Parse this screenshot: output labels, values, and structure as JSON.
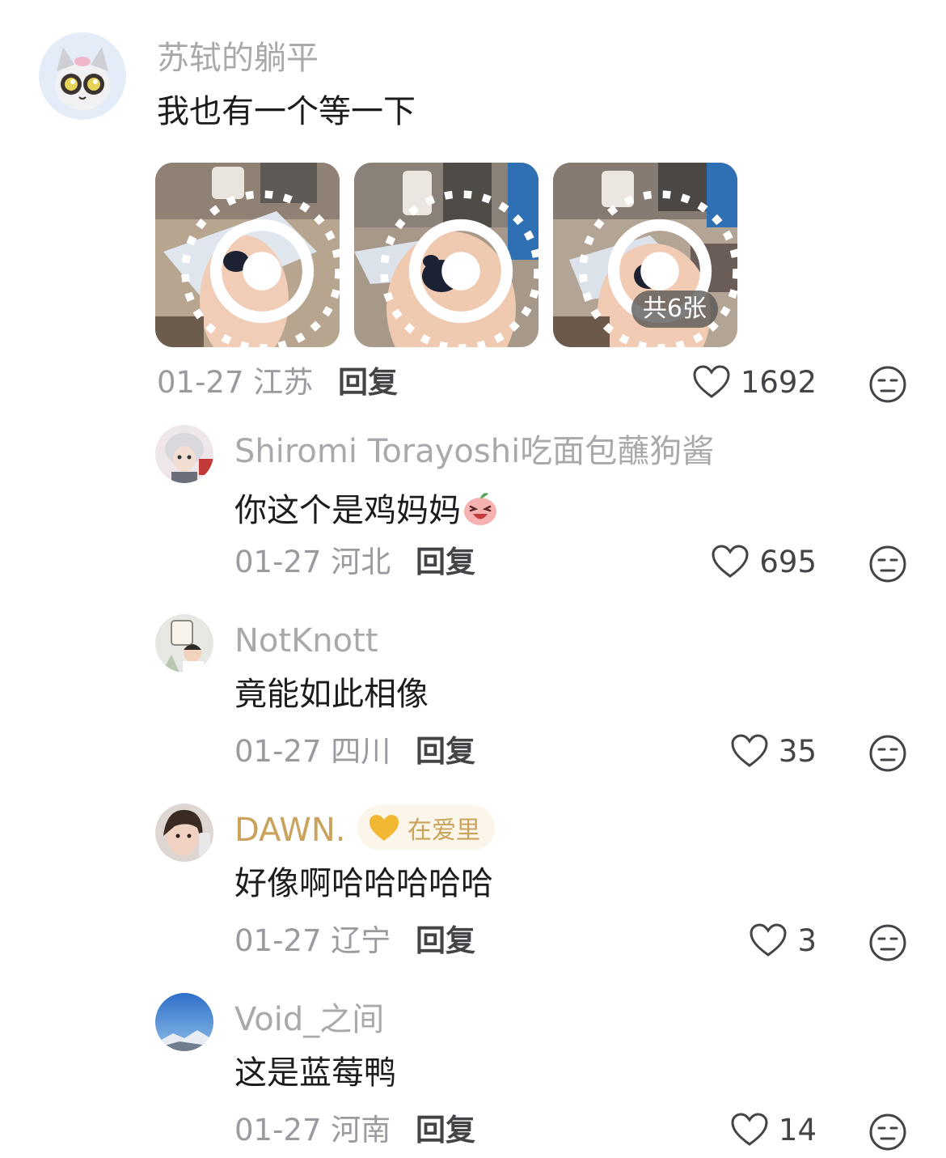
{
  "comments": [
    {
      "username": "苏轼的躺平",
      "text": "我也有一个等一下",
      "date": "01-27",
      "location": "江苏",
      "reply_label": "回复",
      "likes": "1692",
      "images": {
        "count_label": "共6张"
      }
    },
    {
      "username": "Shiromi Torayoshi吃面包蘸狗酱",
      "text": "你这个是鸡妈妈",
      "date": "01-27",
      "location": "河北",
      "reply_label": "回复",
      "likes": "695"
    },
    {
      "username": "NotKnott",
      "text": "竟能如此相像",
      "date": "01-27",
      "location": "四川",
      "reply_label": "回复",
      "likes": "35"
    },
    {
      "username": "DAWN.",
      "badge": "在爱里",
      "text": "好像啊哈哈哈哈哈",
      "date": "01-27",
      "location": "辽宁",
      "reply_label": "回复",
      "likes": "3"
    },
    {
      "username": "Void_之间",
      "text": "这是蓝莓鸭",
      "date": "01-27",
      "location": "河南",
      "reply_label": "回复",
      "likes": "14"
    }
  ],
  "colors": {
    "username": "#a9a9ad",
    "username_highlight": "#c9a25b",
    "text": "#1c1c1e",
    "meta": "#9a9aa0"
  }
}
